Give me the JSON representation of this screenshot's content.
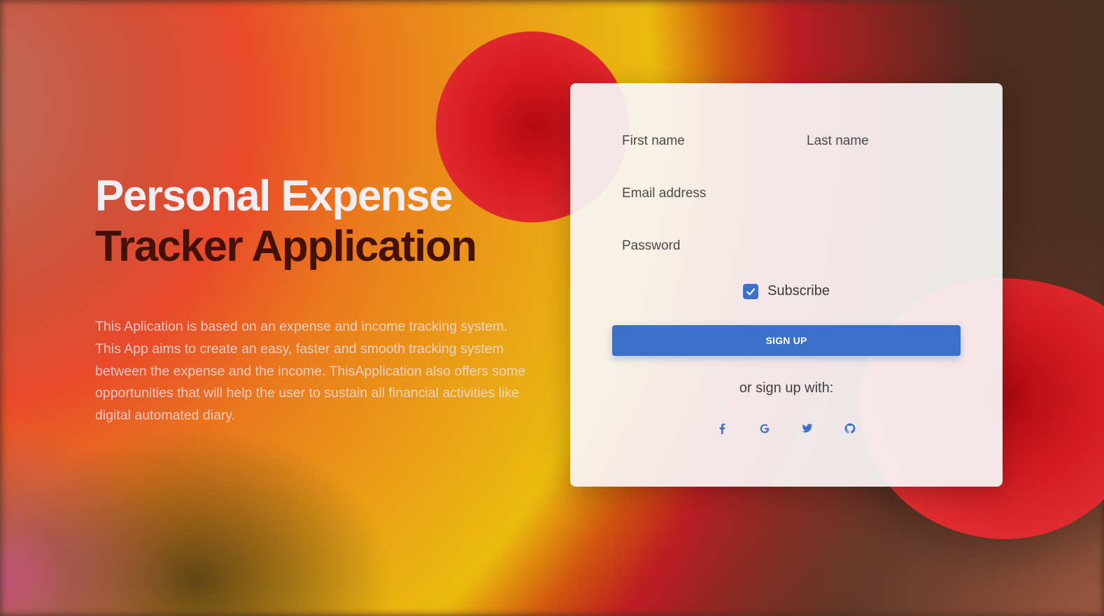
{
  "hero": {
    "title_line1": "Personal Expense",
    "title_line2": "Tracker Application",
    "description": "This Aplication is based on an expense and income tracking system. This App aims to create an easy, faster and smooth tracking system between the expense and the income. ThisApplication also offers some opportunities that will help the user to sustain all financial activities like digital automated diary."
  },
  "form": {
    "first_name_placeholder": "First name",
    "last_name_placeholder": "Last name",
    "email_placeholder": "Email address",
    "password_placeholder": "Password",
    "subscribe_label": "Subscribe",
    "subscribe_checked": true,
    "signup_button": "SIGN UP",
    "or_signup_with": "or sign up with:",
    "social_icons": [
      "facebook-icon",
      "google-icon",
      "twitter-icon",
      "github-icon"
    ]
  },
  "colors": {
    "primary": "#3b71ca",
    "title_light": "#f2eef2",
    "title_dark": "#441108",
    "blob_red": "#e12a2e"
  }
}
